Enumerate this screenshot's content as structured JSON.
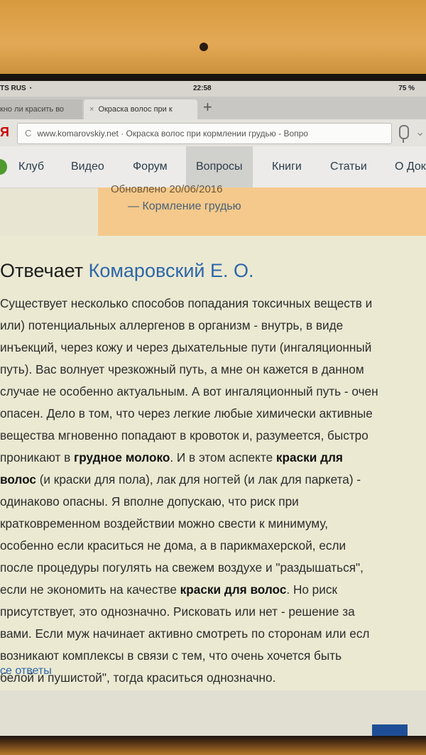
{
  "status": {
    "carrier": "TS RUS",
    "time": "22:58",
    "battery": "75 %"
  },
  "tabs": [
    {
      "label": "кно ли красить во"
    },
    {
      "label": "Окраска волос при к"
    }
  ],
  "address": {
    "brand": "Я",
    "url": "www.komarovskiy.net · Окраска волос при кормлении грудью - Вопро"
  },
  "nav": {
    "items": [
      {
        "label": "Клуб"
      },
      {
        "label": "Видео"
      },
      {
        "label": "Форум"
      },
      {
        "label": "Вопросы"
      },
      {
        "label": "Книги"
      },
      {
        "label": "Статьи"
      },
      {
        "label": "О Док"
      }
    ]
  },
  "info": {
    "updated": "Обновлено 20/06/2016",
    "category": "— Кормление грудью"
  },
  "answer": {
    "title_prefix": "Отвечает ",
    "author": "Комаровский Е. О.",
    "lines": [
      {
        "t1": "Существует несколько способов попадания токсичных веществ и"
      },
      {
        "t1": "или) потенциальных аллергенов в организм - внутрь, в виде"
      },
      {
        "t1": "инъекций, через кожу и через дыхательные пути (ингаляционный"
      },
      {
        "t1": "путь). Вас волнует чрезкожный путь, а мне он кажется в данном"
      },
      {
        "t1": "случае не особенно актуальным. А вот ингаляционный путь - очен"
      },
      {
        "t1": "опасен. Дело в том, что через легкие любые химически активные"
      },
      {
        "t1": "вещества мгновенно попадают в кровоток и, разумеется, быстро"
      },
      {
        "t1": "проникают в ",
        "b1": "грудное молоко",
        "t2": ". И в этом аспекте ",
        "b2": "краски для"
      },
      {
        "b1": "волос",
        "t2": " (и краски для пола), лак для ногтей (и лак для паркета) -"
      },
      {
        "t1": "одинаково опасны. Я вполне допускаю, что риск при"
      },
      {
        "t1": "кратковременном воздействии можно свести к минимуму,"
      },
      {
        "t1": "особенно если краситься не дома, а в парикмахерской, если"
      },
      {
        "t1": "после процедуры погулять на свежем воздухе и \"раздышаться\","
      },
      {
        "t1": "если не экономить на качестве ",
        "b1": "краски для волос",
        "t2": ". Но риск"
      },
      {
        "t1": "присутствует, это однозначно. Рисковать или нет - решение за"
      },
      {
        "t1": "вами. Если муж начинает активно смотреть по сторонам или есл"
      },
      {
        "t1": "возникают комплексы в связи с тем, что очень хочется быть"
      },
      {
        "t1": "белой и пушистой\", тогда краситься однозначно."
      }
    ],
    "all_answers": "се ответы"
  }
}
